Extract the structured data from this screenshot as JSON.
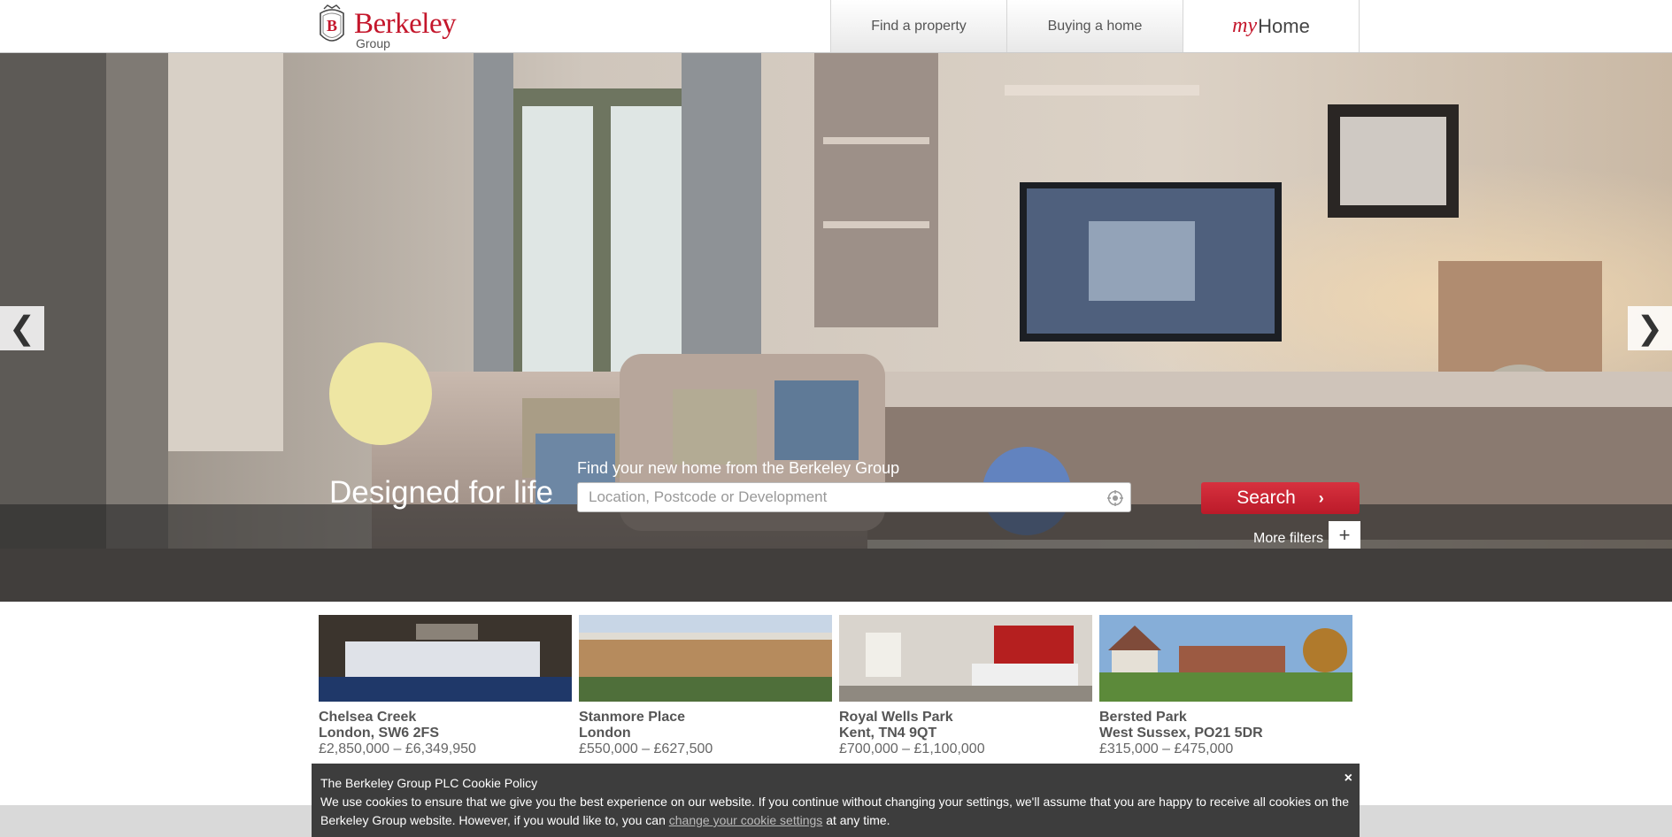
{
  "brand": {
    "name": "Berkeley",
    "sub": "Group"
  },
  "nav": {
    "find": "Find a property",
    "buying": "Buying a home",
    "my_prefix": "my",
    "my_suffix": "Home"
  },
  "hero": {
    "prev": "❮",
    "next": "❯",
    "tagline": "Designed for life",
    "search_label": "Find your new home from the Berkeley Group",
    "search_placeholder": "Location, Postcode or Development",
    "search_button": "Search",
    "search_chevron": "›",
    "more_filters": "More filters",
    "plus": "+"
  },
  "properties": [
    {
      "name": "Chelsea Creek",
      "location": "London, SW6 2FS",
      "price": "£2,850,000 – £6,349,950"
    },
    {
      "name": "Stanmore Place",
      "location": "London",
      "price": "£550,000 – £627,500"
    },
    {
      "name": "Royal Wells Park",
      "location": "Kent, TN4 9QT",
      "price": "£700,000 – £1,100,000"
    },
    {
      "name": "Bersted Park",
      "location": "West Sussex, PO21 5DR",
      "price": "£315,000 – £475,000"
    }
  ],
  "cookie": {
    "title": "The Berkeley Group PLC Cookie Policy",
    "text_before": "We use cookies to ensure that we give you the best experience on our website. If you continue without changing your settings, we'll assume that you are happy to receive all cookies on the Berkeley Group website. However, if you would like to, you can ",
    "link": "change your cookie settings",
    "text_after": " at any time.",
    "close": "×"
  },
  "colors": {
    "brand_red": "#c4162b",
    "search_red": "#c8222f",
    "cookie_bg": "#3d3d3d"
  }
}
